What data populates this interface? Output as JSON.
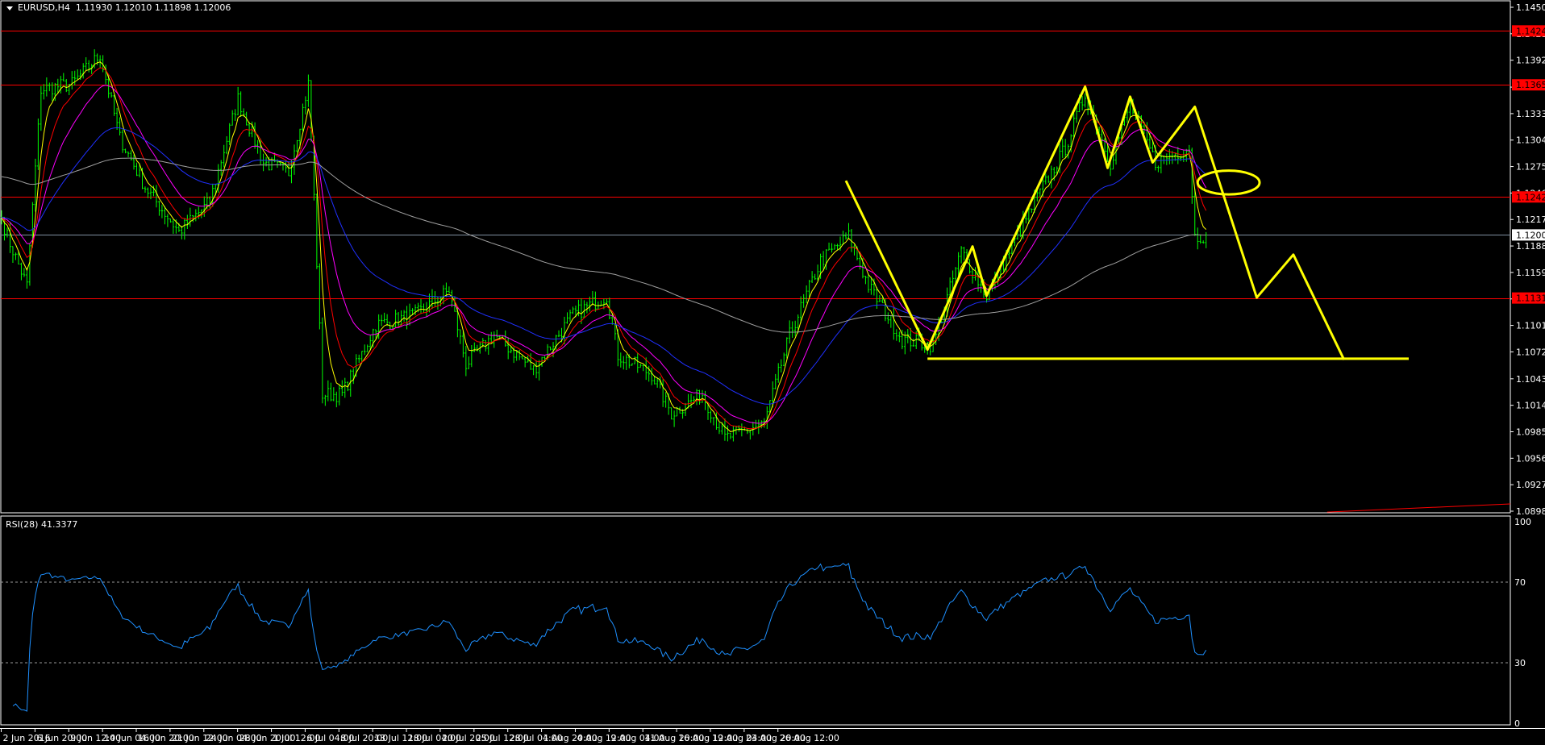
{
  "header": {
    "symbol": "EURUSD,H4",
    "open": "1.11930",
    "high": "1.12010",
    "low": "1.11898",
    "close": "1.12006"
  },
  "indicator": {
    "label": "RSI(28) 41.3377"
  },
  "colors": {
    "bars": "#00ff00",
    "ema_fast": "#ffff00",
    "ema2": "#ff0000",
    "ema3": "#ff00ff",
    "ema4": "#2030ff",
    "ema5": "#a0a0a0",
    "levels": "#ff0000",
    "annotation": "#ffff00",
    "rsi": "#1e90ff",
    "current_price": "#ffffff"
  },
  "chart_data": {
    "type": "ohlc",
    "title": "EURUSD,H4",
    "ylim": [
      1.0898,
      1.145
    ],
    "price_ticks": [
      "1.14500",
      "1.14210",
      "1.13920",
      "1.13625",
      "1.13335",
      "1.13045",
      "1.12755",
      "1.12465",
      "1.12175",
      "1.11885",
      "1.11595",
      "1.11305",
      "1.11015",
      "1.10725",
      "1.10430",
      "1.10140",
      "1.09850",
      "1.09560",
      "1.09270",
      "1.08980"
    ],
    "levels": [
      {
        "price": 1.14241,
        "label": "1.14241"
      },
      {
        "price": 1.1365,
        "label": "1.13650"
      },
      {
        "price": 1.12422,
        "label": "1.12422"
      },
      {
        "price": 1.11315,
        "label": "1.11315"
      }
    ],
    "current_price": {
      "price": 1.12006,
      "label": "1.12006"
    },
    "time_labels": [
      "2 Jun 2016",
      "6 Jun 20:00",
      "9 Jun 12:00",
      "14 Jun 04:00",
      "16 Jun 20:00",
      "21 Jun 12:00",
      "24 Jun 04:00",
      "28 Jun 20:00",
      "1 Jul 12:00",
      "6 Jul 04:00",
      "8 Jul 20:00",
      "13 Jul 12:00",
      "18 Jul 04:00",
      "20 Jul 20:00",
      "25 Jul 12:00",
      "28 Jul 04:00",
      "1 Aug 20:00",
      "4 Aug 12:00",
      "9 Aug 04:00",
      "11 Aug 20:00",
      "16 Aug 12:00",
      "19 Aug 04:00",
      "23 Aug 20:00",
      "26 Aug 12:00"
    ],
    "bars_per_time_label": 12,
    "close_waypoints": [
      [
        0,
        1.122
      ],
      [
        2,
        1.1199
      ],
      [
        9,
        1.1145
      ],
      [
        14,
        1.136
      ],
      [
        25,
        1.1366
      ],
      [
        35,
        1.1398
      ],
      [
        42,
        1.1307
      ],
      [
        51,
        1.1253
      ],
      [
        63,
        1.1204
      ],
      [
        74,
        1.1237
      ],
      [
        84,
        1.135
      ],
      [
        93,
        1.128
      ],
      [
        102,
        1.1269
      ],
      [
        109,
        1.1366
      ],
      [
        111,
        1.1242
      ],
      [
        114,
        1.1026
      ],
      [
        121,
        1.1026
      ],
      [
        133,
        1.1102
      ],
      [
        147,
        1.1113
      ],
      [
        159,
        1.114
      ],
      [
        165,
        1.1059
      ],
      [
        175,
        1.1091
      ],
      [
        189,
        1.1053
      ],
      [
        203,
        1.1113
      ],
      [
        215,
        1.1134
      ],
      [
        219,
        1.1069
      ],
      [
        231,
        1.1048
      ],
      [
        238,
        1.1005
      ],
      [
        249,
        1.1026
      ],
      [
        257,
        1.0978
      ],
      [
        271,
        1.0994
      ],
      [
        280,
        1.1091
      ],
      [
        291,
        1.1172
      ],
      [
        301,
        1.1199
      ],
      [
        308,
        1.1145
      ],
      [
        320,
        1.1086
      ],
      [
        331,
        1.108
      ],
      [
        341,
        1.1183
      ],
      [
        350,
        1.1134
      ],
      [
        368,
        1.1242
      ],
      [
        378,
        1.1296
      ],
      [
        385,
        1.1355
      ],
      [
        394,
        1.128
      ],
      [
        401,
        1.1344
      ],
      [
        410,
        1.128
      ],
      [
        422,
        1.1296
      ],
      [
        424,
        1.1199
      ],
      [
        428,
        1.12006
      ]
    ],
    "moving_averages": [
      5,
      10,
      20,
      50,
      200
    ],
    "rsi": {
      "period": 28,
      "levels": [
        70,
        30
      ],
      "ylim": [
        0,
        100
      ],
      "tick_labels": [
        "100",
        "70",
        "30",
        "0"
      ]
    },
    "annotations": {
      "zigzag": [
        [
          300,
          1.126
        ],
        [
          329,
          1.1075
        ],
        [
          345,
          1.1188
        ],
        [
          350,
          1.1134
        ],
        [
          385,
          1.1363
        ],
        [
          393,
          1.1274
        ],
        [
          401,
          1.1352
        ],
        [
          409,
          1.128
        ],
        [
          424,
          1.1341
        ],
        [
          446,
          1.1132
        ],
        [
          459,
          1.1179
        ],
        [
          477,
          1.1064
        ]
      ],
      "neckline": [
        [
          329,
          1.1065
        ],
        [
          500,
          1.1065
        ]
      ],
      "ellipse": {
        "bar": 436,
        "price": 1.1258,
        "rx_bars": 11,
        "ry_price": 0.0013
      },
      "trendline": [
        [
          471,
          1.0897
        ],
        [
          537,
          1.0906
        ]
      ]
    }
  }
}
